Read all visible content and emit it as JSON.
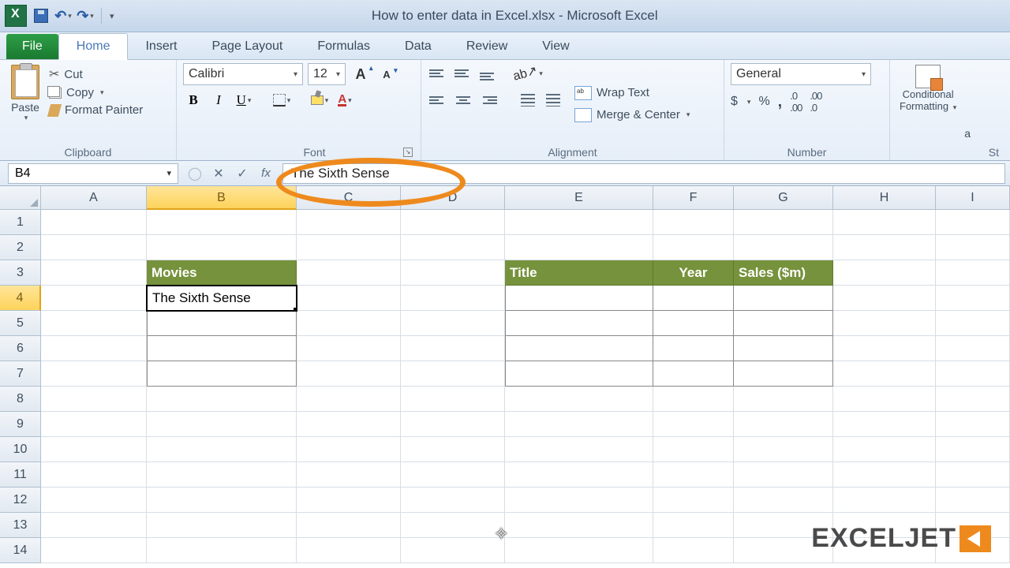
{
  "title": "How to enter data in Excel.xlsx - Microsoft Excel",
  "tabs": {
    "file": "File",
    "home": "Home",
    "insert": "Insert",
    "page_layout": "Page Layout",
    "formulas": "Formulas",
    "data": "Data",
    "review": "Review",
    "view": "View"
  },
  "clipboard": {
    "paste": "Paste",
    "cut": "Cut",
    "copy": "Copy",
    "format_painter": "Format Painter",
    "label": "Clipboard"
  },
  "font": {
    "name": "Calibri",
    "size": "12",
    "label": "Font",
    "bold": "B",
    "italic": "I",
    "underline": "U",
    "color_letter": "A"
  },
  "alignment": {
    "wrap": "Wrap Text",
    "merge": "Merge & Center",
    "label": "Alignment"
  },
  "number": {
    "format": "General",
    "label": "Number",
    "currency": "$",
    "percent": "%",
    "comma": ",",
    "inc": ".00→.0",
    "dec": ".0→.00"
  },
  "styles": {
    "conditional": "Conditional\nFormatting",
    "more": "a"
  },
  "name_box": "B4",
  "formula": "The Sixth Sense",
  "columns": [
    "A",
    "B",
    "C",
    "D",
    "E",
    "F",
    "G",
    "H",
    "I"
  ],
  "row_numbers": [
    "1",
    "2",
    "3",
    "4",
    "5",
    "6",
    "7",
    "8",
    "9",
    "10",
    "11",
    "12",
    "13",
    "14"
  ],
  "sheet": {
    "B3": "Movies",
    "B4": "The Sixth Sense",
    "E3": "Title",
    "F3": "Year",
    "G3": "Sales ($m)"
  },
  "watermark": "EXCELJET"
}
